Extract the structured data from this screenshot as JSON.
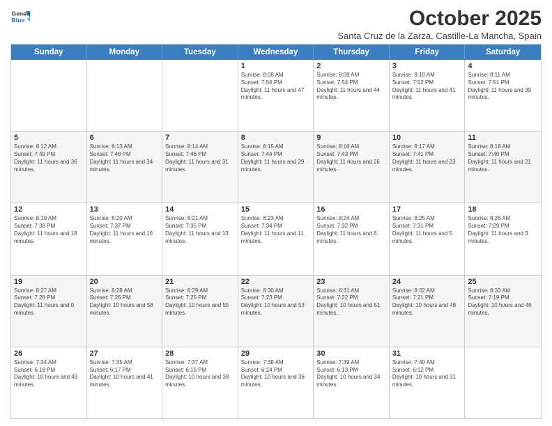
{
  "logo": {
    "general": "General",
    "blue": "Blue"
  },
  "header": {
    "title": "October 2025",
    "subtitle": "Santa Cruz de la Zarza, Castille-La Mancha, Spain"
  },
  "days": [
    "Sunday",
    "Monday",
    "Tuesday",
    "Wednesday",
    "Thursday",
    "Friday",
    "Saturday"
  ],
  "weeks": [
    [
      {
        "day": "",
        "text": ""
      },
      {
        "day": "",
        "text": ""
      },
      {
        "day": "",
        "text": ""
      },
      {
        "day": "1",
        "text": "Sunrise: 8:08 AM\nSunset: 7:56 PM\nDaylight: 11 hours and 47 minutes."
      },
      {
        "day": "2",
        "text": "Sunrise: 8:09 AM\nSunset: 7:54 PM\nDaylight: 11 hours and 44 minutes."
      },
      {
        "day": "3",
        "text": "Sunrise: 8:10 AM\nSunset: 7:52 PM\nDaylight: 11 hours and 41 minutes."
      },
      {
        "day": "4",
        "text": "Sunrise: 8:11 AM\nSunset: 7:51 PM\nDaylight: 11 hours and 39 minutes."
      }
    ],
    [
      {
        "day": "5",
        "text": "Sunrise: 8:12 AM\nSunset: 7:49 PM\nDaylight: 11 hours and 36 minutes."
      },
      {
        "day": "6",
        "text": "Sunrise: 8:13 AM\nSunset: 7:48 PM\nDaylight: 11 hours and 34 minutes."
      },
      {
        "day": "7",
        "text": "Sunrise: 8:14 AM\nSunset: 7:46 PM\nDaylight: 11 hours and 31 minutes."
      },
      {
        "day": "8",
        "text": "Sunrise: 8:15 AM\nSunset: 7:44 PM\nDaylight: 11 hours and 29 minutes."
      },
      {
        "day": "9",
        "text": "Sunrise: 8:16 AM\nSunset: 7:43 PM\nDaylight: 11 hours and 26 minutes."
      },
      {
        "day": "10",
        "text": "Sunrise: 8:17 AM\nSunset: 7:41 PM\nDaylight: 11 hours and 23 minutes."
      },
      {
        "day": "11",
        "text": "Sunrise: 8:18 AM\nSunset: 7:40 PM\nDaylight: 11 hours and 21 minutes."
      }
    ],
    [
      {
        "day": "12",
        "text": "Sunrise: 8:19 AM\nSunset: 7:38 PM\nDaylight: 11 hours and 18 minutes."
      },
      {
        "day": "13",
        "text": "Sunrise: 8:20 AM\nSunset: 7:37 PM\nDaylight: 11 hours and 16 minutes."
      },
      {
        "day": "14",
        "text": "Sunrise: 8:21 AM\nSunset: 7:35 PM\nDaylight: 11 hours and 13 minutes."
      },
      {
        "day": "15",
        "text": "Sunrise: 8:23 AM\nSunset: 7:34 PM\nDaylight: 11 hours and 11 minutes."
      },
      {
        "day": "16",
        "text": "Sunrise: 8:24 AM\nSunset: 7:32 PM\nDaylight: 11 hours and 8 minutes."
      },
      {
        "day": "17",
        "text": "Sunrise: 8:25 AM\nSunset: 7:31 PM\nDaylight: 11 hours and 5 minutes."
      },
      {
        "day": "18",
        "text": "Sunrise: 8:26 AM\nSunset: 7:29 PM\nDaylight: 11 hours and 3 minutes."
      }
    ],
    [
      {
        "day": "19",
        "text": "Sunrise: 8:27 AM\nSunset: 7:28 PM\nDaylight: 11 hours and 0 minutes."
      },
      {
        "day": "20",
        "text": "Sunrise: 8:28 AM\nSunset: 7:26 PM\nDaylight: 10 hours and 58 minutes."
      },
      {
        "day": "21",
        "text": "Sunrise: 8:29 AM\nSunset: 7:25 PM\nDaylight: 10 hours and 55 minutes."
      },
      {
        "day": "22",
        "text": "Sunrise: 8:30 AM\nSunset: 7:23 PM\nDaylight: 10 hours and 53 minutes."
      },
      {
        "day": "23",
        "text": "Sunrise: 8:31 AM\nSunset: 7:22 PM\nDaylight: 10 hours and 51 minutes."
      },
      {
        "day": "24",
        "text": "Sunrise: 8:32 AM\nSunset: 7:21 PM\nDaylight: 10 hours and 48 minutes."
      },
      {
        "day": "25",
        "text": "Sunrise: 8:33 AM\nSunset: 7:19 PM\nDaylight: 10 hours and 46 minutes."
      }
    ],
    [
      {
        "day": "26",
        "text": "Sunrise: 7:34 AM\nSunset: 6:18 PM\nDaylight: 10 hours and 43 minutes."
      },
      {
        "day": "27",
        "text": "Sunrise: 7:35 AM\nSunset: 6:17 PM\nDaylight: 10 hours and 41 minutes."
      },
      {
        "day": "28",
        "text": "Sunrise: 7:37 AM\nSunset: 6:15 PM\nDaylight: 10 hours and 38 minutes."
      },
      {
        "day": "29",
        "text": "Sunrise: 7:38 AM\nSunset: 6:14 PM\nDaylight: 10 hours and 36 minutes."
      },
      {
        "day": "30",
        "text": "Sunrise: 7:39 AM\nSunset: 6:13 PM\nDaylight: 10 hours and 34 minutes."
      },
      {
        "day": "31",
        "text": "Sunrise: 7:40 AM\nSunset: 6:12 PM\nDaylight: 10 hours and 31 minutes."
      },
      {
        "day": "",
        "text": ""
      }
    ]
  ]
}
